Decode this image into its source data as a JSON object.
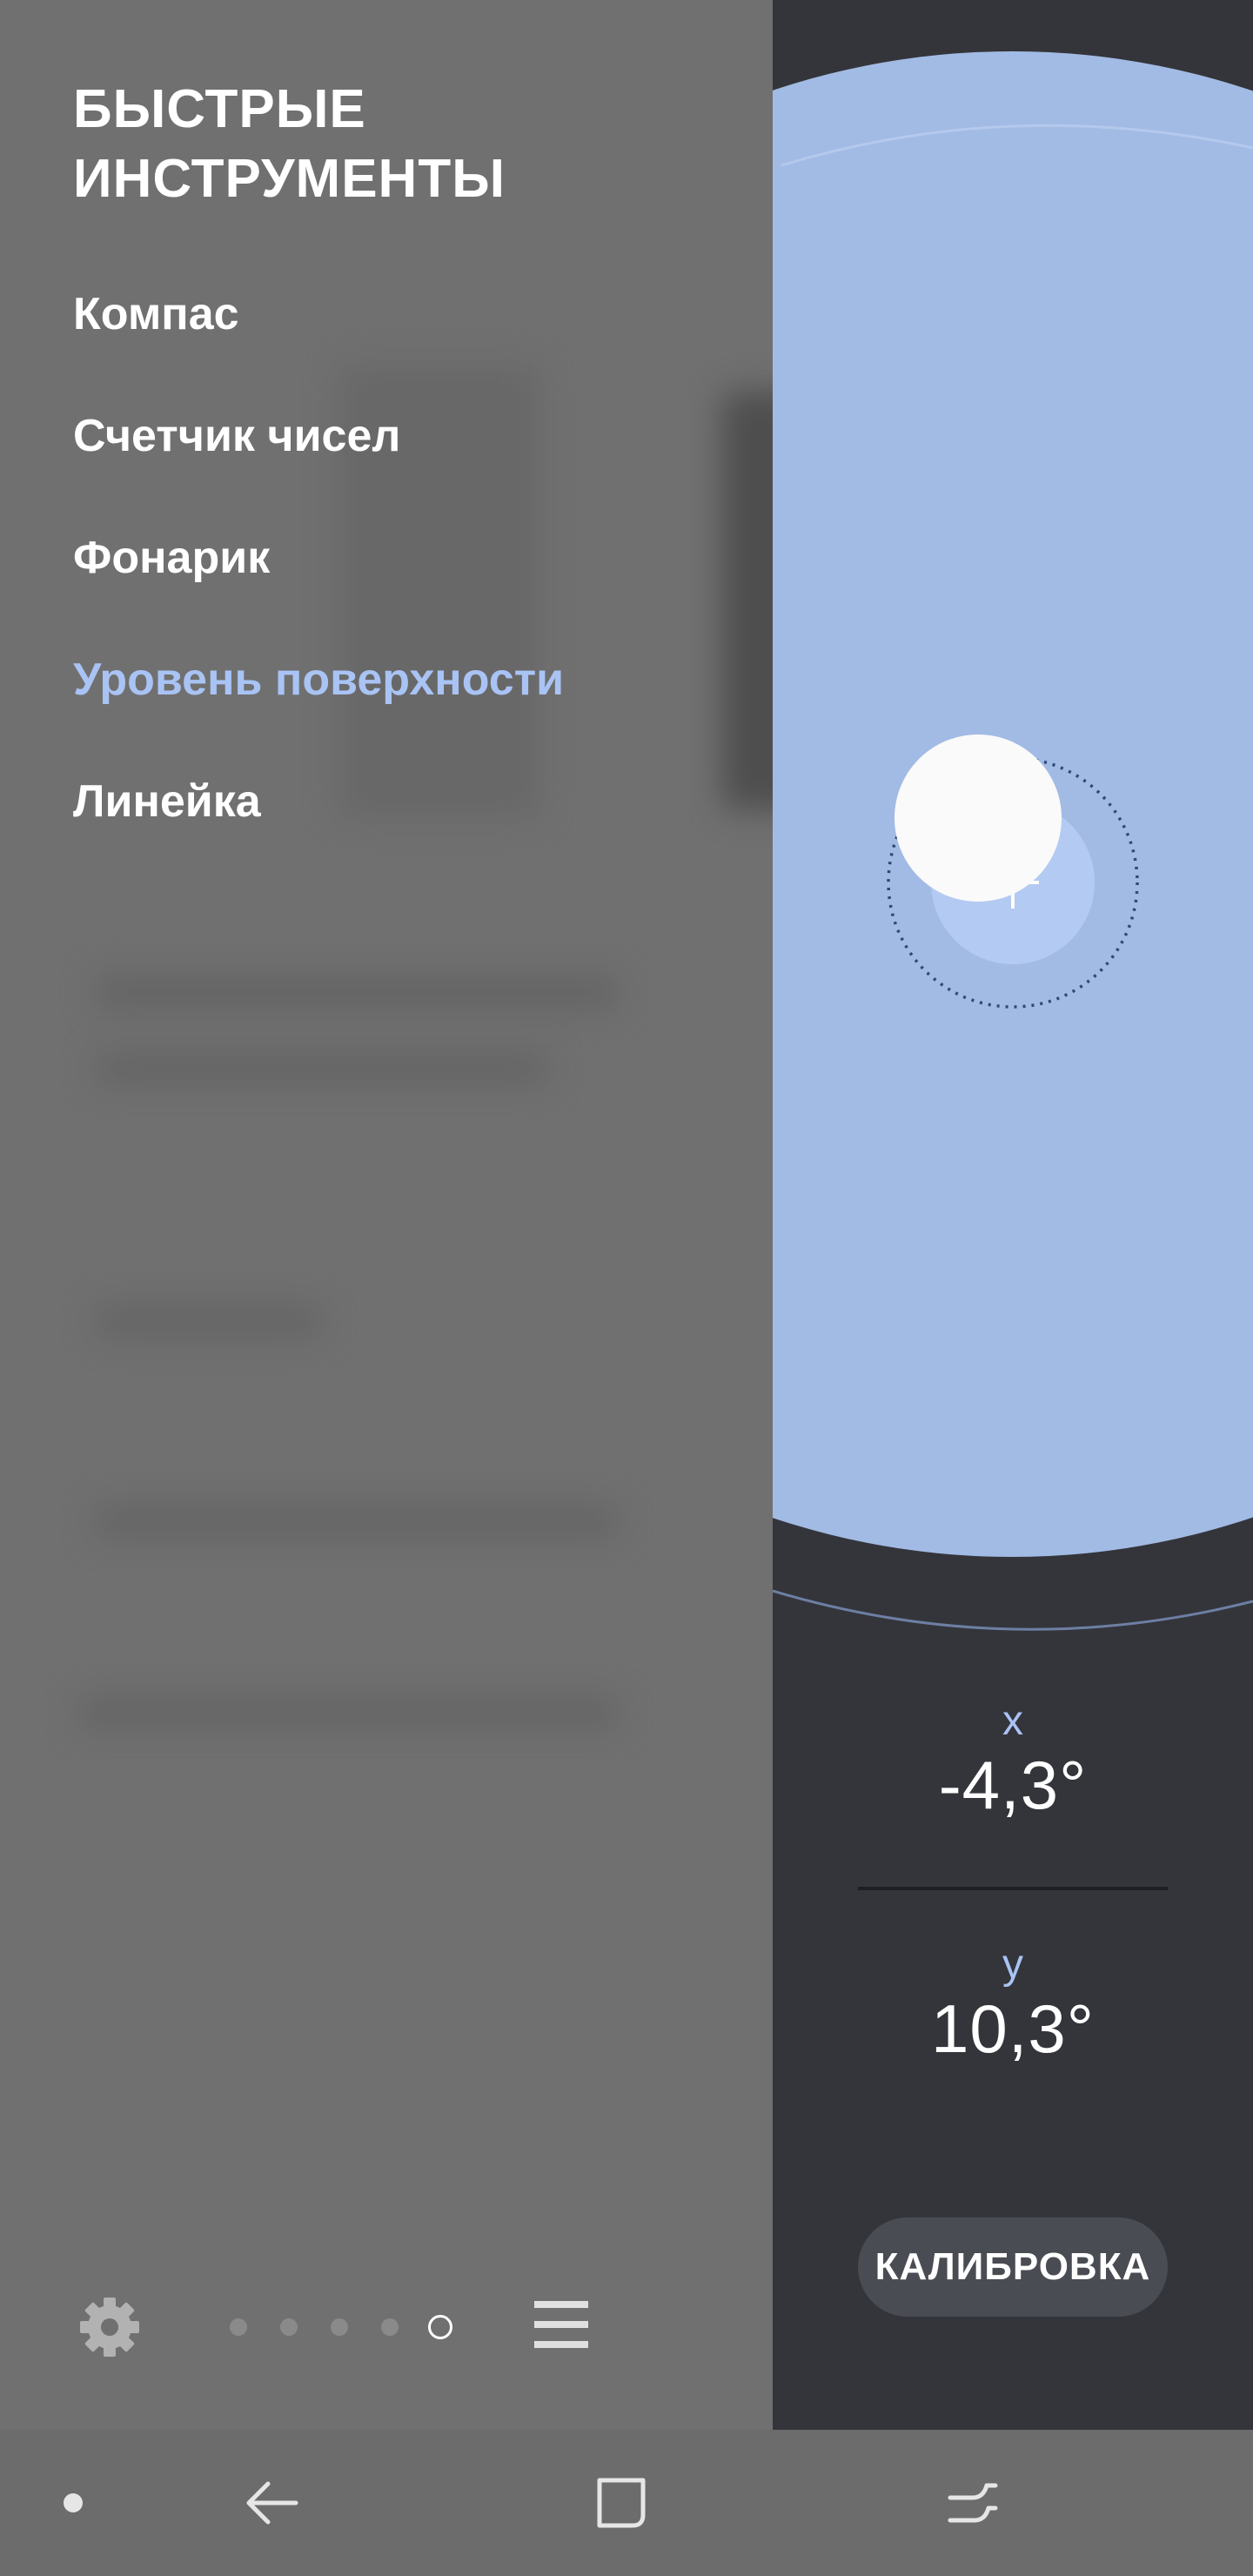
{
  "drawer": {
    "title_line1": "БЫСТРЫЕ",
    "title_line2": "ИНСТРУМЕНТЫ",
    "items": [
      {
        "label": "Компас"
      },
      {
        "label": "Счетчик чисел"
      },
      {
        "label": "Фонарик"
      },
      {
        "label": "Уровень поверхности"
      },
      {
        "label": "Линейка"
      }
    ],
    "active_item": "Уровень поверхности",
    "footer": {
      "settings_icon": "gear-icon",
      "menu_icon": "hamburger-menu-icon",
      "page_count": 5,
      "current_page": 5
    }
  },
  "level": {
    "x_label": "x",
    "x_value": "-4,3°",
    "y_label": "y",
    "y_value": "10,3°",
    "calibrate_label": "КАЛИБРОВКА"
  },
  "nav": {
    "items": [
      "dot-icon",
      "back-icon",
      "home-icon",
      "recents-icon"
    ]
  },
  "colors": {
    "accent": "#a9c3f4",
    "level_disc": "#a2bbe4",
    "drawer_bg": "#707070",
    "tool_bg": "#34353b",
    "nav_bg": "#6c6c6c",
    "bubble": "#fafafa"
  }
}
